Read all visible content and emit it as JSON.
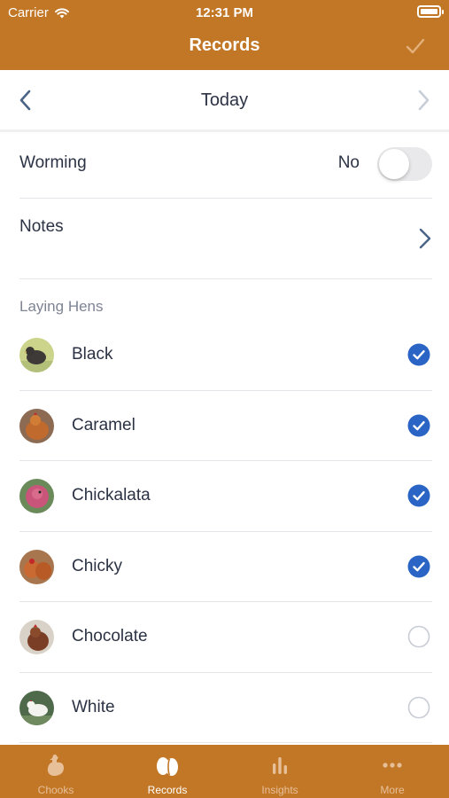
{
  "status_bar": {
    "carrier": "Carrier",
    "time": "12:31 PM"
  },
  "nav": {
    "title": "Records",
    "done_icon": "checkmark-icon"
  },
  "date_nav": {
    "title": "Today",
    "prev_icon": "chevron-left-icon",
    "next_icon": "chevron-right-icon"
  },
  "worming": {
    "label": "Worming",
    "value": "No",
    "enabled": false
  },
  "notes": {
    "label": "Notes"
  },
  "laying_hens": {
    "header": "Laying Hens",
    "hens": [
      {
        "name": "Black",
        "checked": true
      },
      {
        "name": "Caramel",
        "checked": true
      },
      {
        "name": "Chickalata",
        "checked": true
      },
      {
        "name": "Chicky",
        "checked": true
      },
      {
        "name": "Chocolate",
        "checked": false
      },
      {
        "name": "White",
        "checked": false
      }
    ]
  },
  "tabs": [
    {
      "label": "Chooks",
      "icon": "chicken-icon",
      "active": false
    },
    {
      "label": "Records",
      "icon": "eggs-icon",
      "active": true
    },
    {
      "label": "Insights",
      "icon": "bar-chart-icon",
      "active": false
    },
    {
      "label": "More",
      "icon": "ellipsis-icon",
      "active": false
    }
  ],
  "colors": {
    "brand": "#c27726",
    "check_blue": "#2a64c5",
    "text": "#2b3244",
    "muted": "#7e8494"
  }
}
